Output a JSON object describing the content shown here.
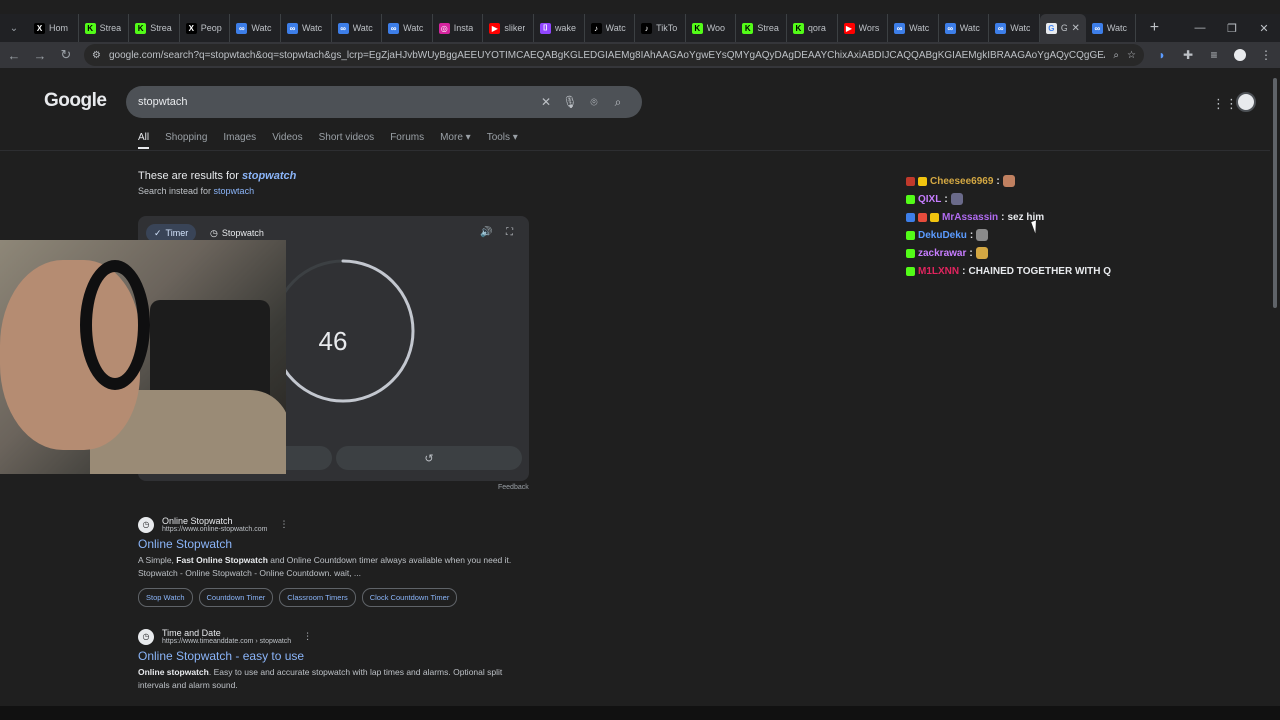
{
  "browser": {
    "tabs": [
      {
        "label": "Hom",
        "fav": "X",
        "fav_color": "#000000",
        "fav_text": "#ffffff"
      },
      {
        "label": "Strea",
        "fav": "K",
        "fav_color": "#53fc18",
        "fav_text": "#000000"
      },
      {
        "label": "Strea",
        "fav": "K",
        "fav_color": "#53fc18",
        "fav_text": "#000000"
      },
      {
        "label": "Peop",
        "fav": "X",
        "fav_color": "#000000",
        "fav_text": "#ffffff"
      },
      {
        "label": "Watc",
        "fav": "∞",
        "fav_color": "#3d7ee8",
        "fav_text": "#ffffff"
      },
      {
        "label": "Watc",
        "fav": "∞",
        "fav_color": "#3d7ee8",
        "fav_text": "#ffffff"
      },
      {
        "label": "Watc",
        "fav": "∞",
        "fav_color": "#3d7ee8",
        "fav_text": "#ffffff"
      },
      {
        "label": "Watc",
        "fav": "∞",
        "fav_color": "#3d7ee8",
        "fav_text": "#ffffff"
      },
      {
        "label": "Insta",
        "fav": "◎",
        "fav_color": "#d6249f",
        "fav_text": "#ffffff"
      },
      {
        "label": "sliker",
        "fav": "▶",
        "fav_color": "#ff0000",
        "fav_text": "#ffffff"
      },
      {
        "label": "wake",
        "fav": "⌷",
        "fav_color": "#9146ff",
        "fav_text": "#ffffff"
      },
      {
        "label": "Watc",
        "fav": "♪",
        "fav_color": "#000000",
        "fav_text": "#ffffff"
      },
      {
        "label": "TikTo",
        "fav": "♪",
        "fav_color": "#000000",
        "fav_text": "#ffffff"
      },
      {
        "label": "Woo",
        "fav": "K",
        "fav_color": "#53fc18",
        "fav_text": "#000000"
      },
      {
        "label": "Strea",
        "fav": "K",
        "fav_color": "#53fc18",
        "fav_text": "#000000"
      },
      {
        "label": "qora",
        "fav": "K",
        "fav_color": "#53fc18",
        "fav_text": "#000000"
      },
      {
        "label": "Wors",
        "fav": "▶",
        "fav_color": "#ff0000",
        "fav_text": "#ffffff"
      },
      {
        "label": "Watc",
        "fav": "∞",
        "fav_color": "#3d7ee8",
        "fav_text": "#ffffff"
      },
      {
        "label": "Watc",
        "fav": "∞",
        "fav_color": "#3d7ee8",
        "fav_text": "#ffffff"
      },
      {
        "label": "Watc",
        "fav": "∞",
        "fav_color": "#3d7ee8",
        "fav_text": "#ffffff"
      }
    ],
    "active_tab": {
      "label": "G",
      "close": "✕"
    },
    "after_tab": {
      "label": "Watc"
    },
    "url": "google.com/search?q=stopwtach&oq=stopwtach&gs_lcrp=EgZjaHJvbWUyBggAEEUYOTIMCAEQABgKGLEDGIAEMg8IAhAAGAoYgwEYsQMYgAQyDAgDEAAYChixAxiABDIJCAQQABgKGIAEMgkIBRAAGAoYgAQyCQgGEAAYChiABDIJCAcQAg..."
  },
  "search": {
    "logo": "Google",
    "query": "stopwtach",
    "tabs": [
      "All",
      "Shopping",
      "Images",
      "Videos",
      "Short videos",
      "Forums",
      "More ▾",
      "Tools ▾"
    ],
    "corrected_prefix": "These are results for ",
    "corrected_term": "stopwatch",
    "instead_prefix": "Search instead for ",
    "instead_term": "stopwtach"
  },
  "widget": {
    "tab_timer": "Timer",
    "tab_stopwatch": "Stopwatch",
    "value": "46",
    "progress_fraction": 0.77,
    "feedback": "Feedback"
  },
  "chat": [
    {
      "user": "Cheesee6969",
      "color": "#d4a843",
      "msg": "",
      "badges": [
        "#c0392b",
        "#f1c40f"
      ],
      "emote": "#c08060"
    },
    {
      "user": "QIXL",
      "color": "#c77dff",
      "msg": "",
      "badges": [
        "#53fc18"
      ],
      "emote": "#6a6a8a"
    },
    {
      "user": "MrAssassin",
      "color": "#b06bf0",
      "msg": "sez him",
      "badges": [
        "#3d7ee8",
        "#e74c3c",
        "#f1c40f"
      ],
      "emote": ""
    },
    {
      "user": "DekuDeku",
      "color": "#5b9bff",
      "msg": "",
      "badges": [
        "#53fc18"
      ],
      "emote": "#8a8a8a"
    },
    {
      "user": "zackrawar",
      "color": "#c77dff",
      "msg": "",
      "badges": [
        "#53fc18"
      ],
      "emote": "#d4a843"
    },
    {
      "user": "M1LXNN",
      "color": "#e0245e",
      "msg": "CHAINED TOGETHER WITH Q",
      "badges": [
        "#53fc18"
      ],
      "emote": ""
    }
  ],
  "results": [
    {
      "site": "Online Stopwatch",
      "url": "https://www.online-stopwatch.com",
      "title": "Online Stopwatch",
      "snippet_parts": [
        {
          "t": "A Simple, ",
          "b": false
        },
        {
          "t": "Fast Online Stopwatch",
          "b": true
        },
        {
          "t": " and Online Countdown timer always available when you need it. Stopwatch - Online Stopwatch - Online Countdown. wait, ...",
          "b": false
        }
      ],
      "chips": [
        "Stop Watch",
        "Countdown Timer",
        "Classroom Timers",
        "Clock Countdown Timer"
      ]
    },
    {
      "site": "Time and Date",
      "url": "https://www.timeanddate.com › stopwatch",
      "title": "Online Stopwatch - easy to use",
      "snippet_parts": [
        {
          "t": "Online stopwatch",
          "b": true
        },
        {
          "t": ". Easy to use and accurate stopwatch with lap times and alarms. Optional split intervals and alarm sound.",
          "b": false
        }
      ],
      "chips": []
    }
  ]
}
